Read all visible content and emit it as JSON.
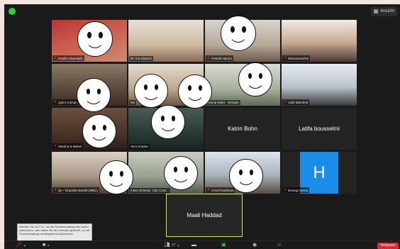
{
  "topbar": {
    "view_label": "Ansicht",
    "view_icon": "grid-icon"
  },
  "participants": [
    {
      "name": "Rosilia Glueckich",
      "muted": true
    },
    {
      "name": "Dr. Ina Saumel",
      "muted": false
    },
    {
      "name": "Fremel Hanna",
      "muted": true
    },
    {
      "name": "thomasvachini",
      "muted": true
    },
    {
      "name": "Quim Comas",
      "muted": true
    },
    {
      "name": "Mo",
      "muted": false
    },
    {
      "name": "Hanna Suter · Semper",
      "muted": false
    },
    {
      "name": "Julia Marchett",
      "muted": true
    },
    {
      "name": "Martina & Manel",
      "muted": true
    },
    {
      "name": "Vera Krause",
      "muted": false
    },
    {
      "name": "Katrin Bohn",
      "muted": false
    },
    {
      "name": "Latifa bousselmi",
      "muted": false
    },
    {
      "name": "Ily – Graciela Morelli (WBC)",
      "muted": true
    },
    {
      "name": "Inken Schmitz, City Cons...",
      "muted": false
    },
    {
      "name": "Anneli Karlsson",
      "muted": true
    },
    {
      "name": "Bevegi Hanna",
      "muted": true
    }
  ],
  "active_speaker": {
    "name": "Maali Haddad"
  },
  "hanna_initial": "H",
  "tooltip": {
    "text": "Drücken Sie ‹ALT+A›, um die Stummschaltung des Audios aufzuheben, oder halten Sie die Leertaste gedrückt, um die Stummschaltung vorübergehend aufzuheben."
  },
  "toolbar": {
    "participants_count": "17",
    "leave_label": "Verlassen"
  },
  "colors": {
    "active_border": "#c8e84a",
    "leave_red": "#e0282e",
    "mute_red": "#e03030",
    "h_blue": "#1a8de8"
  }
}
